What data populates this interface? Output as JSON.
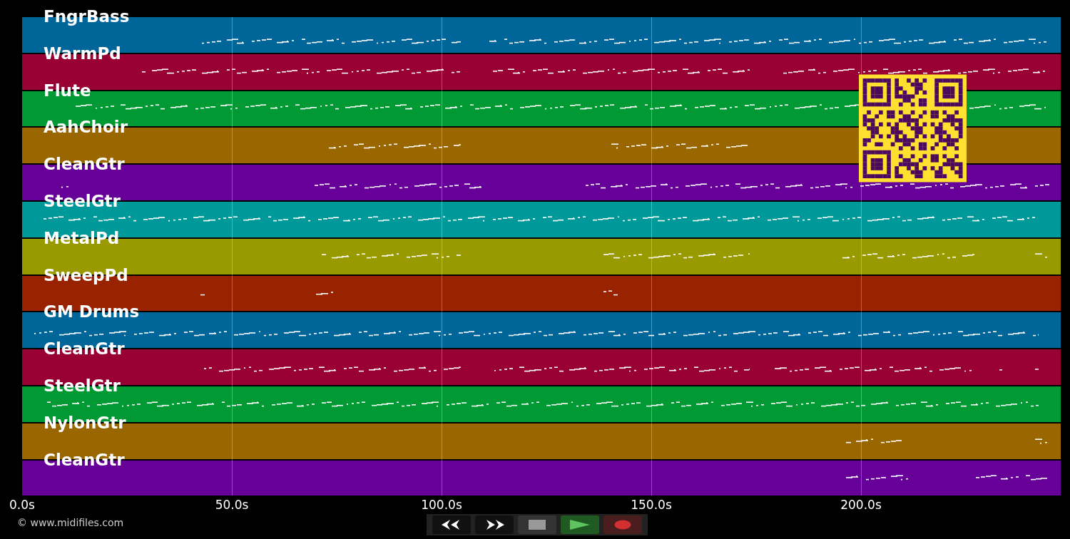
{
  "tracks": [
    {
      "name": "FngrBass",
      "color": "#006699"
    },
    {
      "name": "WarmPd",
      "color": "#990033"
    },
    {
      "name": "Flute",
      "color": "#009933"
    },
    {
      "name": "AahChoir",
      "color": "#996600"
    },
    {
      "name": "CleanGtr",
      "color": "#660099"
    },
    {
      "name": "SteelGtr",
      "color": "#009999"
    },
    {
      "name": "MetalPd",
      "color": "#999900"
    },
    {
      "name": "SweepPd",
      "color": "#992200"
    },
    {
      "name": "GM Drums",
      "color": "#006699"
    },
    {
      "name": "CleanGtr",
      "color": "#990033"
    },
    {
      "name": "SteelGtr",
      "color": "#009933"
    },
    {
      "name": "NylonGtr",
      "color": "#996600"
    },
    {
      "name": "CleanGtr",
      "color": "#660099"
    }
  ],
  "time_axis": {
    "ticks": [
      "0.0s",
      "50.0s",
      "100.0s",
      "150.0s",
      "200.0s"
    ]
  },
  "footer": {
    "copyright": "© www.midifiles.com"
  }
}
